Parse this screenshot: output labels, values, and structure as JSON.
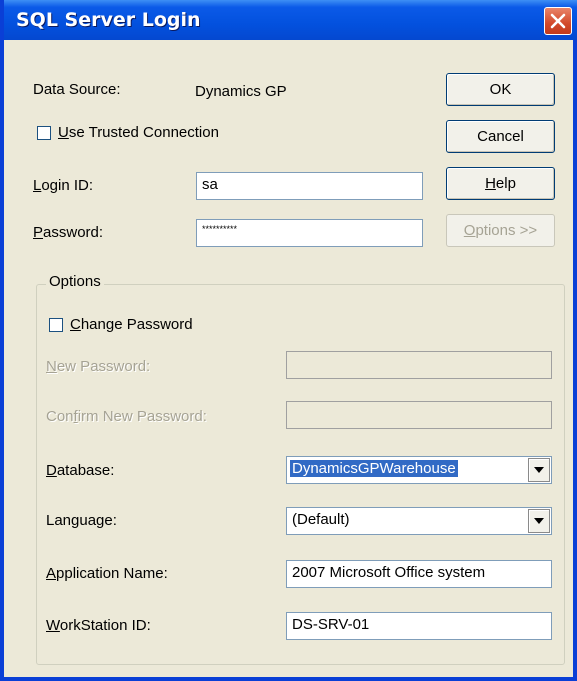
{
  "window": {
    "title": "SQL Server Login"
  },
  "data_source": {
    "label": "Data Source:",
    "value": "Dynamics GP"
  },
  "trusted": {
    "label_key": "U",
    "label_rest": "se Trusted Connection",
    "checked": false
  },
  "login": {
    "label_key": "L",
    "label_rest": "ogin ID:",
    "value": "sa"
  },
  "password": {
    "label_key": "P",
    "label_rest": "assword:",
    "value": "**********"
  },
  "buttons": {
    "ok": "OK",
    "cancel": "Cancel",
    "help_key": "H",
    "help_rest": "elp",
    "options_key": "O",
    "options_rest": "ptions >>"
  },
  "options": {
    "group_label": "Options",
    "change_password": {
      "label_key": "C",
      "label_rest": "hange Password",
      "checked": false
    },
    "new_password": {
      "label_key": "N",
      "label_rest": "ew Password:",
      "value": ""
    },
    "confirm_password": {
      "label_pre": "Con",
      "label_key": "f",
      "label_rest": "irm New Password:",
      "value": ""
    },
    "database": {
      "label_key": "D",
      "label_rest": "atabase:",
      "value": "DynamicsGPWarehouse"
    },
    "language": {
      "label": "Language:",
      "value": "(Default)"
    },
    "application_name": {
      "label_key": "A",
      "label_rest": "pplication Name:",
      "value": "2007 Microsoft Office system"
    },
    "workstation_id": {
      "label_key": "W",
      "label_rest": "orkStation ID:",
      "value": "DS-SRV-01"
    }
  }
}
